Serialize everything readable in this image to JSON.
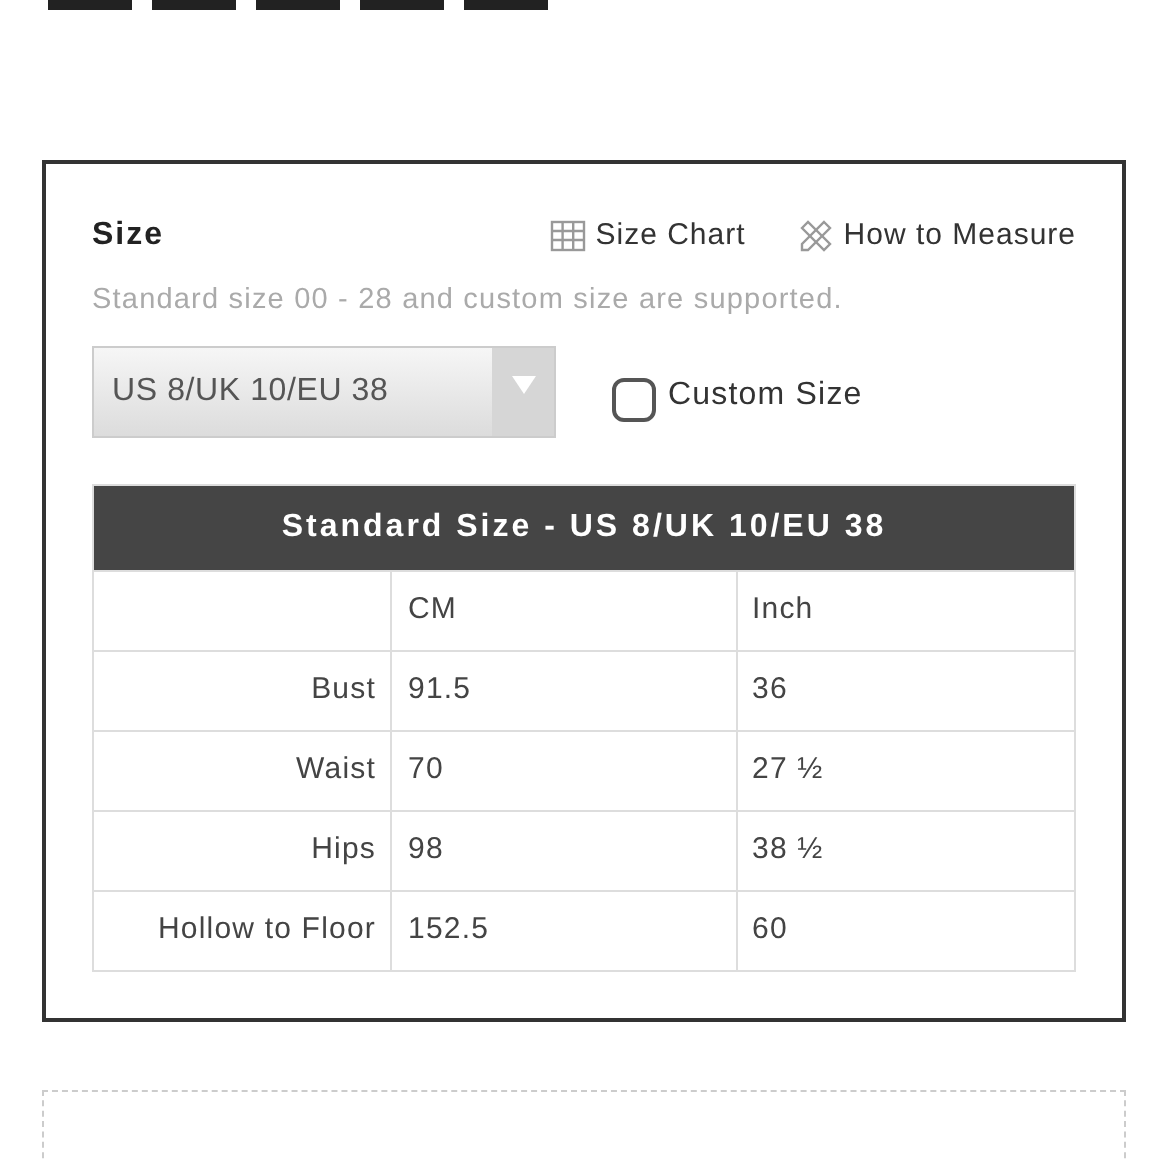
{
  "size_section": {
    "label": "Size",
    "links": [
      "Size Chart",
      "How to Measure"
    ],
    "note": "Standard size 00 - 28 and custom size are supported.",
    "select": {
      "value": "US 8/UK 10/EU 38"
    },
    "custom_size": {
      "label": "Custom Size",
      "checked": false
    },
    "table": {
      "title": "Standard Size - US 8/UK 10/EU 38",
      "columns": [
        "CM",
        "Inch"
      ],
      "rows": [
        {
          "label": "Bust",
          "cm": "91.5",
          "inch": "36"
        },
        {
          "label": "Waist",
          "cm": "70",
          "inch": "27 ½"
        },
        {
          "label": "Hips",
          "cm": "98",
          "inch": "38 ½"
        },
        {
          "label": "Hollow to Floor",
          "cm": "152.5",
          "inch": "60"
        }
      ]
    }
  }
}
